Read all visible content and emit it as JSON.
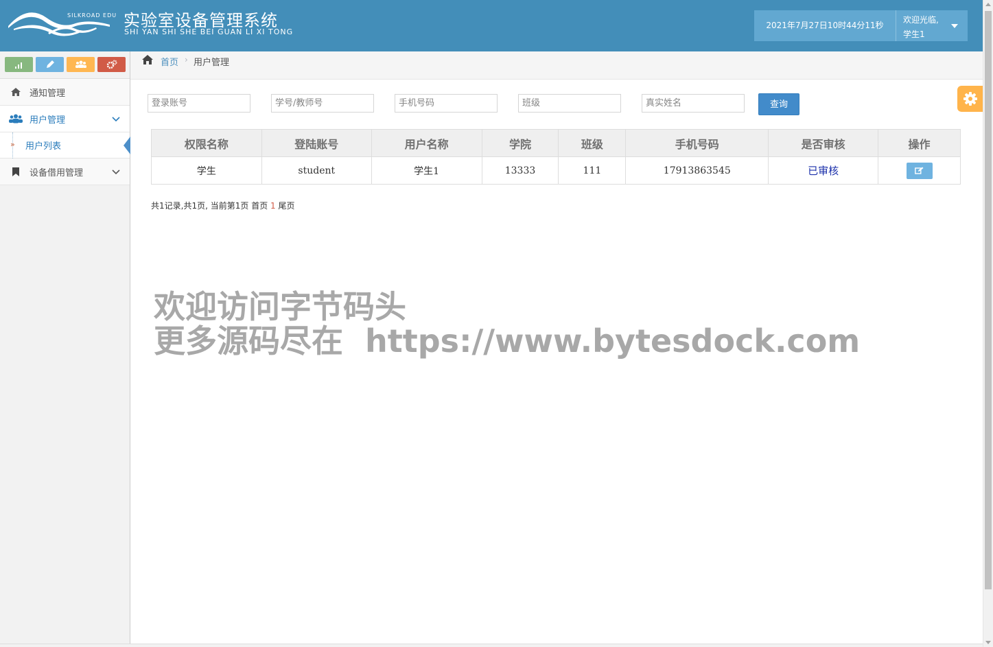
{
  "header": {
    "logo_small_text": "SILKROAD EDU",
    "title": "实验室设备管理系统",
    "pinyin": "SHI YAN SHI SHE BEI GUAN LI XI TONG",
    "datetime": "2021年7月27日10时44分11秒",
    "welcome": "欢迎光临,",
    "username": "学生1"
  },
  "sidebar": {
    "shortcuts": [
      "signal-icon",
      "pencil-icon",
      "users-icon",
      "cogs-icon"
    ],
    "items": [
      {
        "label": "通知管理",
        "icon": "home-icon"
      },
      {
        "label": "用户管理",
        "icon": "users-icon",
        "expanded": true
      },
      {
        "label": "设备借用管理",
        "icon": "bookmark-icon"
      }
    ],
    "subitem": "用户列表"
  },
  "breadcrumb": {
    "home": "首页",
    "current": "用户管理"
  },
  "search": {
    "account_placeholder": "登录账号",
    "student_no_placeholder": "学号/教师号",
    "phone_placeholder": "手机号码",
    "class_placeholder": "班级",
    "realname_placeholder": "真实姓名",
    "query_label": "查询"
  },
  "table": {
    "headers": [
      "权限名称",
      "登陆账号",
      "用户名称",
      "学院",
      "班级",
      "手机号码",
      "是否审核",
      "操作"
    ],
    "rows": [
      {
        "role": "学生",
        "account": "student",
        "name": "学生1",
        "college": "13333",
        "class": "111",
        "phone": "17913863545",
        "audit": "已审核"
      }
    ]
  },
  "pager": {
    "summary": "共1记录,共1页, 当前第1页",
    "first": "首页",
    "current": "1",
    "last": "尾页"
  },
  "watermark": {
    "line1": "欢迎访问字节码头",
    "line2": "更多源码尽在  https://www.bytesdock.com"
  },
  "colors": {
    "header": "#438eb9",
    "accent": "#428bca",
    "audit": "#1a2faa"
  }
}
